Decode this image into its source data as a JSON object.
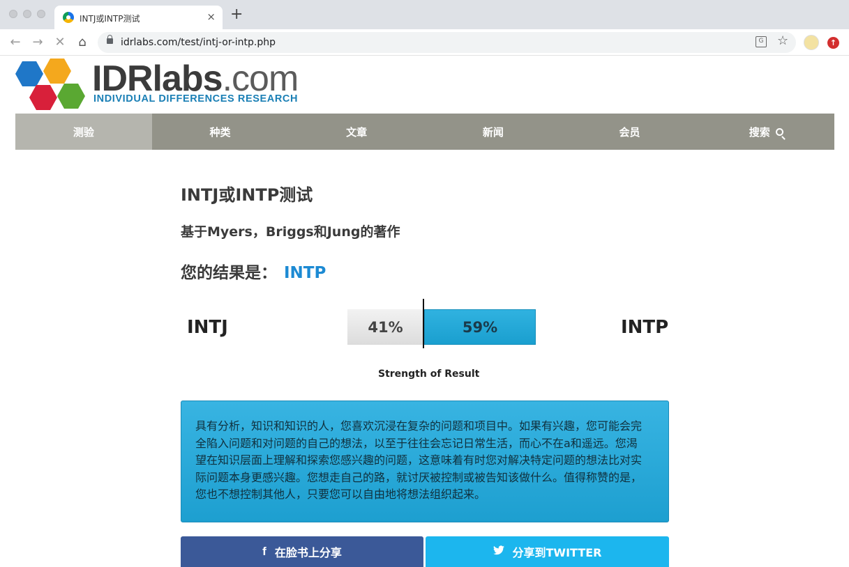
{
  "browser": {
    "tab_title": "INTJ或INTP测试",
    "tab_close": "×",
    "new_tab": "+",
    "url": "idrlabs.com/test/intj-or-intp.php",
    "translate_glyph": "G",
    "star_glyph": "☆",
    "ext_glyph": "↑"
  },
  "logo": {
    "brand": "IDRlabs",
    "tld": ".com",
    "tagline": "INDIVIDUAL DIFFERENCES RESEARCH",
    "hex_colors": [
      "#1f77c8",
      "#f4a81d",
      "#d8203a",
      "#5aa832"
    ]
  },
  "nav": {
    "items": [
      "测验",
      "种类",
      "文章",
      "新闻",
      "会员",
      "搜索"
    ],
    "active_index": 0
  },
  "page": {
    "title": "INTJ或INTP测试",
    "subtitle": "基于Myers，Briggs和Jung的著作",
    "result_prefix": "您的结果是：",
    "result_type": "INTP"
  },
  "result_bar": {
    "left_type": "INTJ",
    "right_type": "INTP",
    "left_percent_label": "41%",
    "right_percent_label": "59%",
    "left_percent": 41,
    "right_percent": 59,
    "strength_label": "Strength of Result",
    "accent_color": "#1c8ad3"
  },
  "description": {
    "text": "具有分析，知识和知识的人，您喜欢沉浸在复杂的问题和项目中。如果有兴趣，您可能会完全陷入问题和对问题的自己的想法，以至于往往会忘记日常生活，而心不在a和遥远。您渴望在知识层面上理解和探索您感兴趣的问题，这意味着有时您对解决特定问题的想法比对实际问题本身更感兴趣。您想走自己的路，就讨厌被控制或被告知该做什么。值得称赞的是，您也不想控制其他人，只要您可以自由地将想法组织起来。"
  },
  "share": {
    "facebook_icon": "f",
    "facebook_label": "在脸书上分享",
    "twitter_icon": "🐦",
    "twitter_label": "分享到TWITTER",
    "facebook_color": "#3b5998",
    "twitter_color": "#1cb6ee"
  }
}
